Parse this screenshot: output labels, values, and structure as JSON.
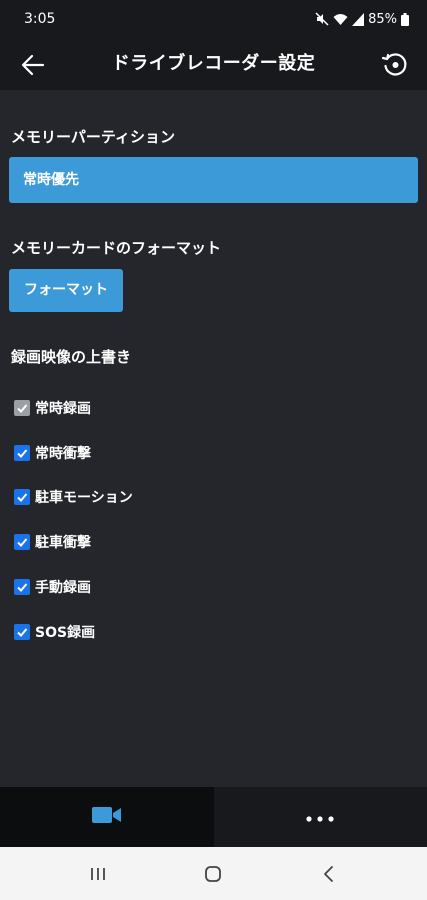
{
  "status_bar": {
    "time": "3:05",
    "battery": "85%",
    "icons": [
      "mute-icon",
      "wifi-icon",
      "signal-icon",
      "battery-icon"
    ]
  },
  "app_bar": {
    "title": "ドライブレコーダー設定",
    "back_icon": "arrow-left-icon",
    "reset_icon": "restore-icon"
  },
  "memory_partition": {
    "title": "メモリーパーティション",
    "selected_value": "常時優先"
  },
  "memory_format": {
    "title": "メモリーカードのフォーマット",
    "button_label": "フォーマット"
  },
  "overwrite": {
    "title": "録画映像の上書き",
    "items": [
      {
        "label": "常時録画",
        "checked": true,
        "disabled": true
      },
      {
        "label": "常時衝撃",
        "checked": true,
        "disabled": false
      },
      {
        "label": "駐車モーション",
        "checked": true,
        "disabled": false
      },
      {
        "label": "駐車衝撃",
        "checked": true,
        "disabled": false
      },
      {
        "label": "手動録画",
        "checked": true,
        "disabled": false
      },
      {
        "label": "SOS録画",
        "checked": true,
        "disabled": false
      }
    ]
  },
  "bottom_nav": {
    "tabs": [
      {
        "icon": "video-camera-icon",
        "active": true
      },
      {
        "icon": "more-horizontal-icon",
        "active": false
      }
    ]
  },
  "system_nav": {
    "buttons": [
      "recent-apps-icon",
      "home-icon",
      "back-icon"
    ]
  },
  "colors": {
    "background": "#24262b",
    "bar_background": "#17191c",
    "accent_blue": "#3d9ad9",
    "checkbox_blue": "#1a73e8",
    "checkbox_disabled": "#9aa0a6"
  }
}
